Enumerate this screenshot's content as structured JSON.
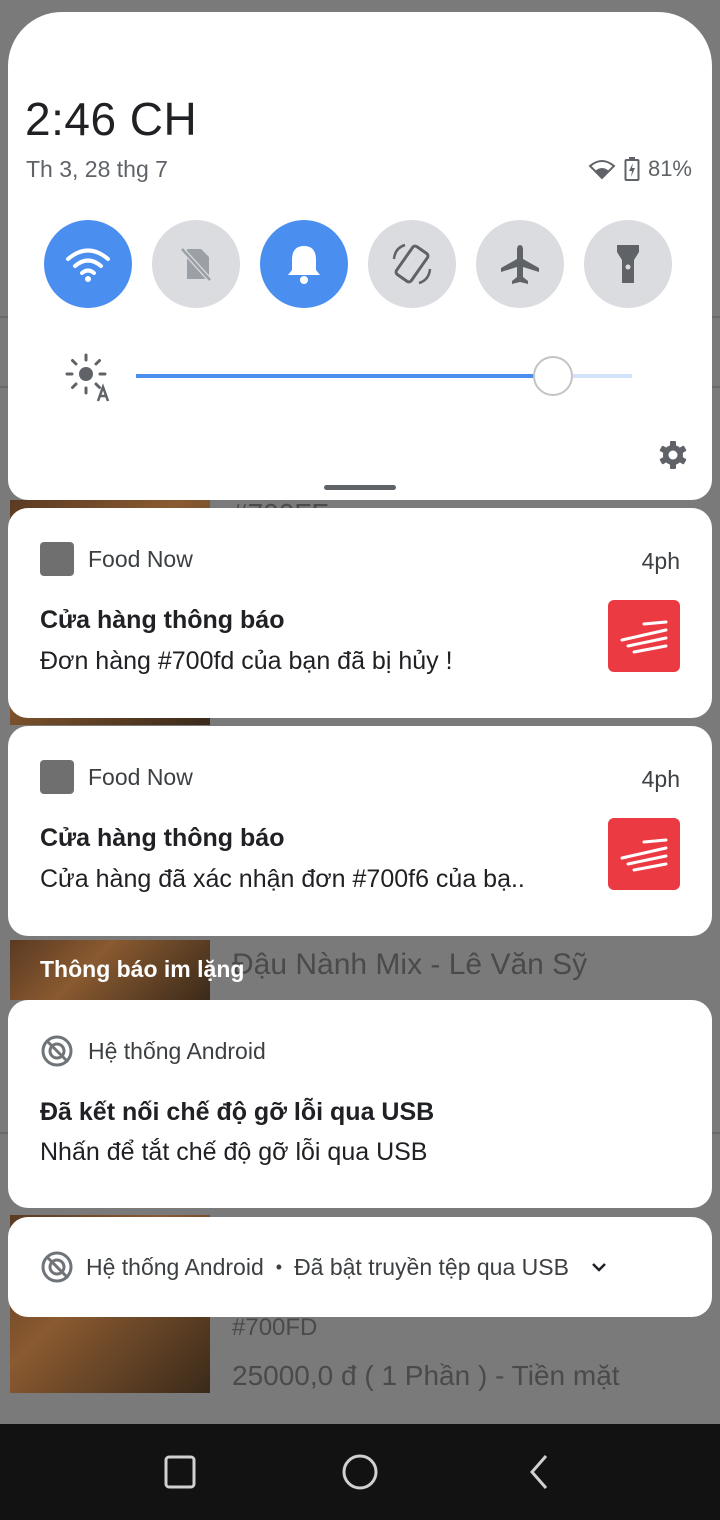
{
  "status_bar": {
    "time": "2:46 CH",
    "date": "Th 3, 28 thg 7",
    "battery": "81%"
  },
  "quick_settings": {
    "tiles": [
      {
        "name": "wifi-icon",
        "active": true
      },
      {
        "name": "sim-off-icon",
        "active": false
      },
      {
        "name": "bell-icon",
        "active": true
      },
      {
        "name": "auto-rotate-icon",
        "active": false
      },
      {
        "name": "airplane-icon",
        "active": false
      },
      {
        "name": "flashlight-icon",
        "active": false
      }
    ],
    "brightness_level": 0.84
  },
  "background_app": {
    "order_code_partial": "#700FF",
    "shop_name": "Đậu Nành Mix - Lê Văn Sỹ",
    "order_code": "#700FD",
    "order_detail": "25000,0 đ ( 1 Phần ) - Tiền mặt"
  },
  "notifications": [
    {
      "app": "Food Now",
      "time": "4ph",
      "title": "Cửa hàng thông báo",
      "body": "Đơn hàng #700fd của bạn đã bị hủy !"
    },
    {
      "app": "Food Now",
      "time": "4ph",
      "title": "Cửa hàng thông báo",
      "body": "Cửa hàng đã xác nhận đơn #700f6 của bạ.."
    }
  ],
  "silent_header": "Thông báo im lặng",
  "silent_notifications": [
    {
      "app": "Hệ thống Android",
      "title": "Đã kết nối chế độ gỡ lỗi qua USB",
      "body": "Nhấn để tắt chế độ gỡ lỗi qua USB"
    },
    {
      "app": "Hệ thống Android",
      "separator": "•",
      "summary": "Đã bật truyền tệp qua USB"
    }
  ]
}
